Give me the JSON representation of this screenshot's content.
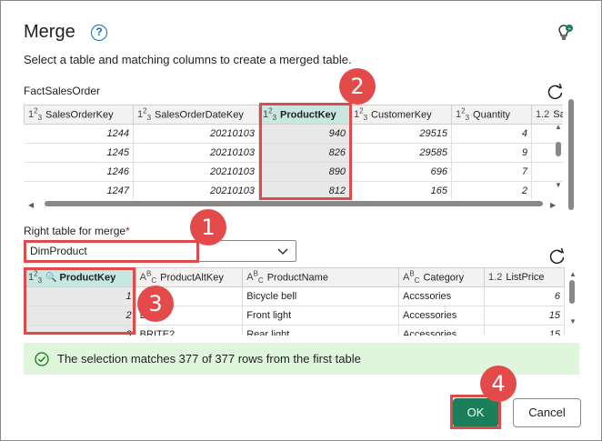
{
  "dialog": {
    "title": "Merge",
    "subtitle": "Select a table and matching columns to create a merged table."
  },
  "first_table": {
    "name": "FactSalesOrder",
    "columns": [
      {
        "type": "123",
        "label": "SalesOrderKey"
      },
      {
        "type": "123",
        "label": "SalesOrderDateKey"
      },
      {
        "type": "123",
        "label": "ProductKey",
        "selected": true
      },
      {
        "type": "123",
        "label": "CustomerKey"
      },
      {
        "type": "123",
        "label": "Quantity"
      },
      {
        "type": "1.2",
        "label": "Sal"
      }
    ],
    "rows": [
      [
        "1244",
        "20210103",
        "940",
        "29515",
        "4",
        ""
      ],
      [
        "1245",
        "20210103",
        "826",
        "29585",
        "9",
        ""
      ],
      [
        "1246",
        "20210103",
        "890",
        "696",
        "7",
        ""
      ],
      [
        "1247",
        "20210103",
        "812",
        "165",
        "2",
        ""
      ]
    ]
  },
  "right_table": {
    "label": "Right table for merge",
    "required_mark": "*",
    "selected": "DimProduct",
    "columns": [
      {
        "type": "123",
        "label": "ProductKey",
        "selected": true,
        "key": true
      },
      {
        "type": "ABC",
        "label": "ProductAltKey"
      },
      {
        "type": "ABC",
        "label": "ProductName"
      },
      {
        "type": "ABC",
        "label": "Category"
      },
      {
        "type": "1.2",
        "label": "ListPrice"
      }
    ],
    "rows": [
      [
        "1",
        "",
        "Bicycle bell",
        "Accssories",
        "6"
      ],
      [
        "2",
        "B",
        "Front light",
        "Accessories",
        "15"
      ],
      [
        "3",
        "BRITE2",
        "Rear light",
        "Accessories",
        "15"
      ]
    ]
  },
  "match": {
    "text": "The selection matches 377 of 377 rows from the first table"
  },
  "buttons": {
    "ok": "OK",
    "cancel": "Cancel"
  },
  "callouts": [
    "1",
    "2",
    "3",
    "4"
  ],
  "colors": {
    "accent": "#1a7f5a",
    "highlight": "#e04a4a",
    "selected_header": "#c7e8e0",
    "success_bar": "#dff6dd"
  }
}
